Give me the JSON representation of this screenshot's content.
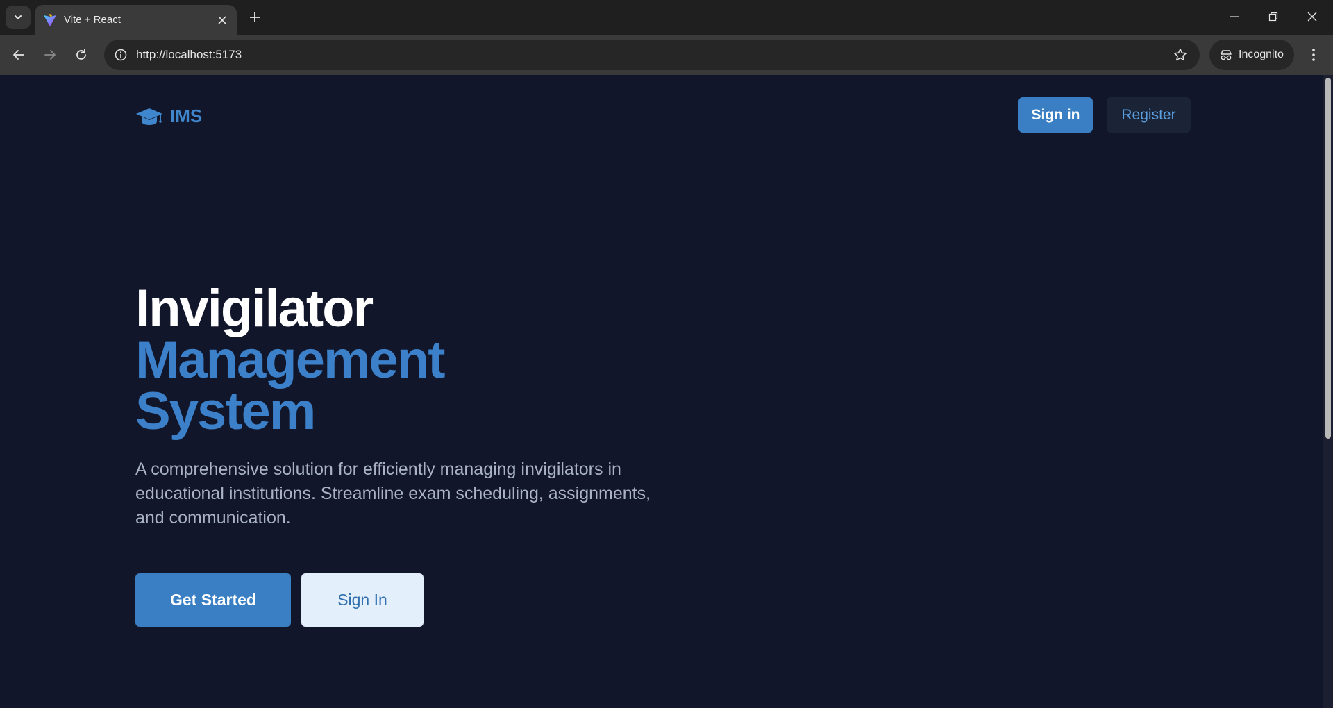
{
  "browser": {
    "tab": {
      "title": "Vite + React"
    },
    "address_bar": {
      "url": "http://localhost:5173"
    },
    "incognito_label": "Incognito"
  },
  "header": {
    "brand": "IMS",
    "sign_in": "Sign in",
    "register": "Register"
  },
  "hero": {
    "title_line_1": "Invigilator",
    "title_line_2": "Management",
    "title_line_3": "System",
    "description": "A comprehensive solution for efficiently managing invigilators in educational institutions. Streamline exam scheduling, assignments, and communication.",
    "primary_button": "Get Started",
    "secondary_button": "Sign In"
  },
  "colors": {
    "page_background": "#11162a",
    "accent": "#3a7fc3",
    "description_text": "#a9b3c4",
    "secondary_button_bg": "#e3effb"
  },
  "icons": {
    "tab_search": "chevron-down-icon",
    "favicon": "vite-logo-icon",
    "tab_close": "close-icon",
    "new_tab": "plus-icon",
    "back": "arrow-left-icon",
    "forward": "arrow-right-icon",
    "reload": "reload-icon",
    "site_info": "info-icon",
    "bookmark": "star-icon",
    "incognito": "incognito-icon",
    "menu": "kebab-menu-icon",
    "brand": "graduation-cap-icon"
  }
}
